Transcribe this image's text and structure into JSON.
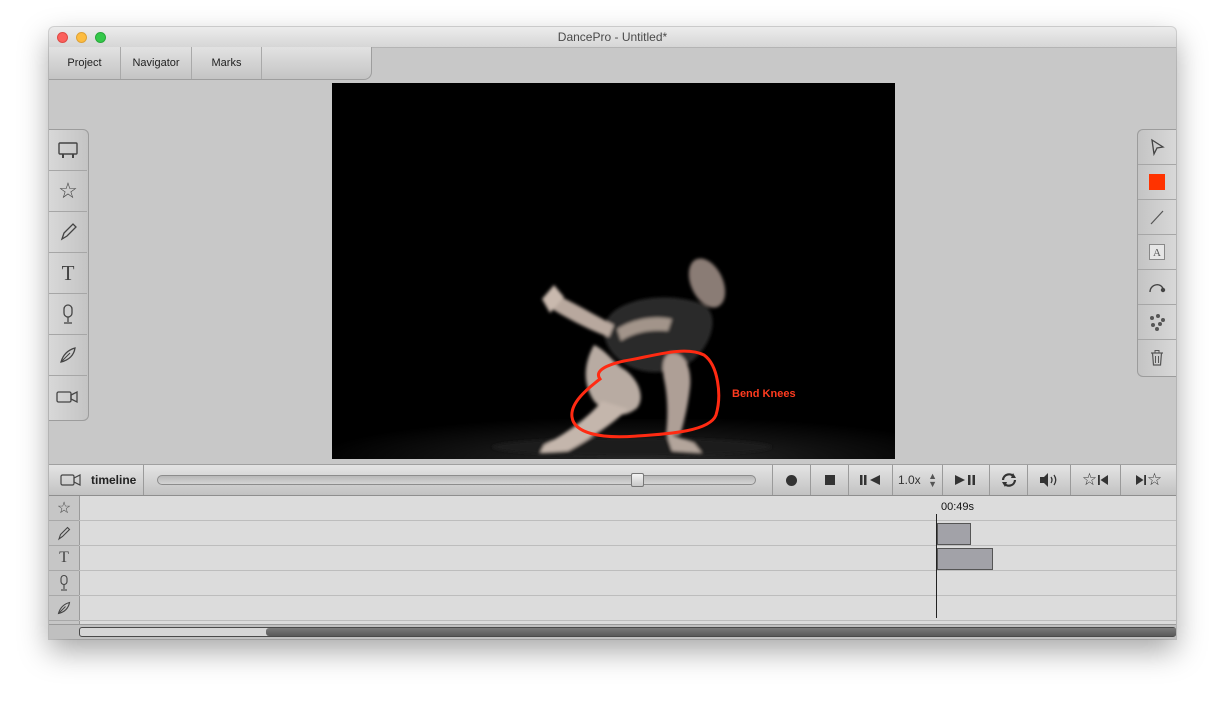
{
  "window": {
    "title": "DancePro - Untitled*"
  },
  "menu": {
    "tabs": [
      "Project",
      "Navigator",
      "Marks"
    ]
  },
  "left_tools": [
    "layout-icon",
    "star-icon",
    "pencil-icon",
    "text-icon",
    "microphone-icon",
    "pen-nib-icon",
    "video-camera-icon"
  ],
  "right_tools": [
    "pointer-icon",
    "color-swatch",
    "line-icon",
    "text-box-icon",
    "curve-arrow-icon",
    "dots-icon",
    "trash-icon"
  ],
  "colors": {
    "accent_red": "#ff3b1f",
    "swatch": "#ff3300"
  },
  "video": {
    "annotation_label": "Bend Knees"
  },
  "transport": {
    "timeline_label": "timeline",
    "speed": "1.0x",
    "scrub_position": 0.81
  },
  "timeline": {
    "current_time": "00:49s",
    "tracks": [
      "star-icon",
      "pencil-icon",
      "text-icon",
      "microphone-icon",
      "pen-nib-icon"
    ]
  }
}
